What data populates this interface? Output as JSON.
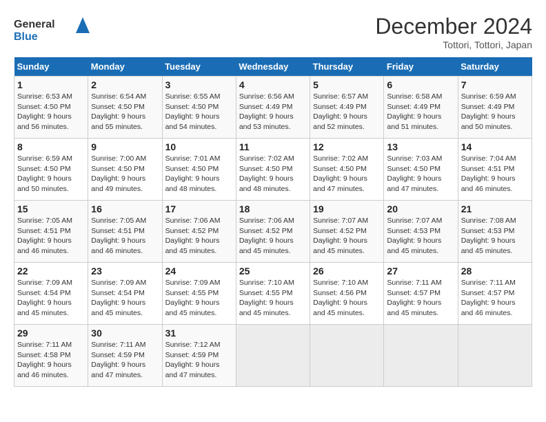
{
  "header": {
    "logo_general": "General",
    "logo_blue": "Blue",
    "month_title": "December 2024",
    "location": "Tottori, Tottori, Japan"
  },
  "weekdays": [
    "Sunday",
    "Monday",
    "Tuesday",
    "Wednesday",
    "Thursday",
    "Friday",
    "Saturday"
  ],
  "weeks": [
    [
      {
        "day": "1",
        "detail": "Sunrise: 6:53 AM\nSunset: 4:50 PM\nDaylight: 9 hours\nand 56 minutes."
      },
      {
        "day": "2",
        "detail": "Sunrise: 6:54 AM\nSunset: 4:50 PM\nDaylight: 9 hours\nand 55 minutes."
      },
      {
        "day": "3",
        "detail": "Sunrise: 6:55 AM\nSunset: 4:50 PM\nDaylight: 9 hours\nand 54 minutes."
      },
      {
        "day": "4",
        "detail": "Sunrise: 6:56 AM\nSunset: 4:49 PM\nDaylight: 9 hours\nand 53 minutes."
      },
      {
        "day": "5",
        "detail": "Sunrise: 6:57 AM\nSunset: 4:49 PM\nDaylight: 9 hours\nand 52 minutes."
      },
      {
        "day": "6",
        "detail": "Sunrise: 6:58 AM\nSunset: 4:49 PM\nDaylight: 9 hours\nand 51 minutes."
      },
      {
        "day": "7",
        "detail": "Sunrise: 6:59 AM\nSunset: 4:49 PM\nDaylight: 9 hours\nand 50 minutes."
      }
    ],
    [
      {
        "day": "8",
        "detail": "Sunrise: 6:59 AM\nSunset: 4:50 PM\nDaylight: 9 hours\nand 50 minutes."
      },
      {
        "day": "9",
        "detail": "Sunrise: 7:00 AM\nSunset: 4:50 PM\nDaylight: 9 hours\nand 49 minutes."
      },
      {
        "day": "10",
        "detail": "Sunrise: 7:01 AM\nSunset: 4:50 PM\nDaylight: 9 hours\nand 48 minutes."
      },
      {
        "day": "11",
        "detail": "Sunrise: 7:02 AM\nSunset: 4:50 PM\nDaylight: 9 hours\nand 48 minutes."
      },
      {
        "day": "12",
        "detail": "Sunrise: 7:02 AM\nSunset: 4:50 PM\nDaylight: 9 hours\nand 47 minutes."
      },
      {
        "day": "13",
        "detail": "Sunrise: 7:03 AM\nSunset: 4:50 PM\nDaylight: 9 hours\nand 47 minutes."
      },
      {
        "day": "14",
        "detail": "Sunrise: 7:04 AM\nSunset: 4:51 PM\nDaylight: 9 hours\nand 46 minutes."
      }
    ],
    [
      {
        "day": "15",
        "detail": "Sunrise: 7:05 AM\nSunset: 4:51 PM\nDaylight: 9 hours\nand 46 minutes."
      },
      {
        "day": "16",
        "detail": "Sunrise: 7:05 AM\nSunset: 4:51 PM\nDaylight: 9 hours\nand 46 minutes."
      },
      {
        "day": "17",
        "detail": "Sunrise: 7:06 AM\nSunset: 4:52 PM\nDaylight: 9 hours\nand 45 minutes."
      },
      {
        "day": "18",
        "detail": "Sunrise: 7:06 AM\nSunset: 4:52 PM\nDaylight: 9 hours\nand 45 minutes."
      },
      {
        "day": "19",
        "detail": "Sunrise: 7:07 AM\nSunset: 4:52 PM\nDaylight: 9 hours\nand 45 minutes."
      },
      {
        "day": "20",
        "detail": "Sunrise: 7:07 AM\nSunset: 4:53 PM\nDaylight: 9 hours\nand 45 minutes."
      },
      {
        "day": "21",
        "detail": "Sunrise: 7:08 AM\nSunset: 4:53 PM\nDaylight: 9 hours\nand 45 minutes."
      }
    ],
    [
      {
        "day": "22",
        "detail": "Sunrise: 7:09 AM\nSunset: 4:54 PM\nDaylight: 9 hours\nand 45 minutes."
      },
      {
        "day": "23",
        "detail": "Sunrise: 7:09 AM\nSunset: 4:54 PM\nDaylight: 9 hours\nand 45 minutes."
      },
      {
        "day": "24",
        "detail": "Sunrise: 7:09 AM\nSunset: 4:55 PM\nDaylight: 9 hours\nand 45 minutes."
      },
      {
        "day": "25",
        "detail": "Sunrise: 7:10 AM\nSunset: 4:55 PM\nDaylight: 9 hours\nand 45 minutes."
      },
      {
        "day": "26",
        "detail": "Sunrise: 7:10 AM\nSunset: 4:56 PM\nDaylight: 9 hours\nand 45 minutes."
      },
      {
        "day": "27",
        "detail": "Sunrise: 7:11 AM\nSunset: 4:57 PM\nDaylight: 9 hours\nand 45 minutes."
      },
      {
        "day": "28",
        "detail": "Sunrise: 7:11 AM\nSunset: 4:57 PM\nDaylight: 9 hours\nand 46 minutes."
      }
    ],
    [
      {
        "day": "29",
        "detail": "Sunrise: 7:11 AM\nSunset: 4:58 PM\nDaylight: 9 hours\nand 46 minutes."
      },
      {
        "day": "30",
        "detail": "Sunrise: 7:11 AM\nSunset: 4:59 PM\nDaylight: 9 hours\nand 47 minutes."
      },
      {
        "day": "31",
        "detail": "Sunrise: 7:12 AM\nSunset: 4:59 PM\nDaylight: 9 hours\nand 47 minutes."
      },
      null,
      null,
      null,
      null
    ]
  ]
}
